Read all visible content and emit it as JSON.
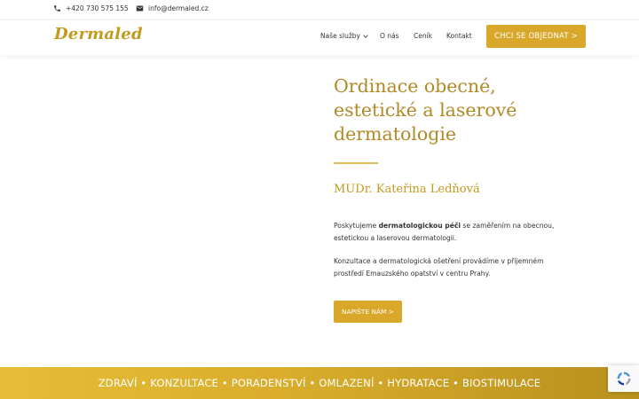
{
  "topbar": {
    "phone": "+420 730 575 155",
    "email": "info@dermaled.cz"
  },
  "header": {
    "logo": "Dermaled",
    "nav": {
      "services": "Naše služby",
      "about": "O nás",
      "pricing": "Ceník",
      "contact": "Kontakt"
    },
    "cta": "CHCI SE OBJEDNAT >"
  },
  "hero": {
    "title": "Ordinace obecné, estetické a laserové dermatologie",
    "doctor": "MUDr. Kateřina Ledňová",
    "para1_prefix": "Poskytujeme ",
    "para1_bold": "dermatologickou péči",
    "para1_suffix": " se zaměřením na obecnou, estetickou a laserovou dermatologii.",
    "para2": "Konzultace a dermatologická ošetření provádíme v příjemném prostředí Emauzského opatství v centru Prahy.",
    "button": "NAPIŠTE NÁM >"
  },
  "band": {
    "text": "ZDRAVÍ • KONZULTACE • PORADENSTVÍ • OMLAZENÍ • HYDRATACE  • BIOSTIMULACE"
  },
  "colors": {
    "accent": "#d9a72a",
    "title": "#b08a25"
  }
}
